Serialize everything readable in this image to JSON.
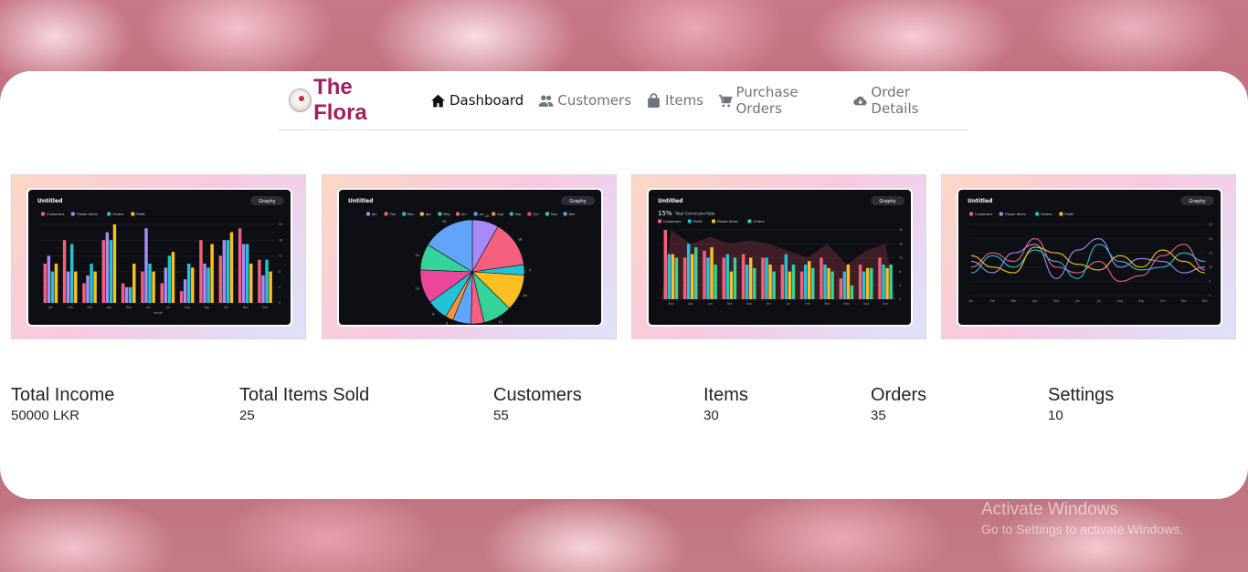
{
  "app": {
    "brand": "The Flora"
  },
  "nav": {
    "items": [
      {
        "label": "Dashboard",
        "icon": "home-icon",
        "active": true
      },
      {
        "label": "Customers",
        "icon": "users-icon",
        "active": false
      },
      {
        "label": "Items",
        "icon": "bag-icon",
        "active": false
      },
      {
        "label": "Purchase Orders",
        "icon": "cart-icon",
        "active": false
      },
      {
        "label": "Order Details",
        "icon": "cloud-download-icon",
        "active": false
      }
    ]
  },
  "cards": [
    {
      "title": "Untitled",
      "badge": "Graphy",
      "chart": "bar"
    },
    {
      "title": "Untitled",
      "badge": "Graphy",
      "chart": "pie"
    },
    {
      "title": "Untitled",
      "badge": "Graphy",
      "chart": "bar",
      "header_value": "15%",
      "header_label": "Total Conversion Rate"
    },
    {
      "title": "Untitled",
      "badge": "Graphy",
      "chart": "line"
    }
  ],
  "chart_data": [
    {
      "type": "bar",
      "title": "Untitled",
      "categories": [
        "Jan",
        "Feb",
        "Mar",
        "Apr",
        "May",
        "Jun",
        "Jul",
        "Aug",
        "Sep",
        "Oct",
        "Nov",
        "Dec"
      ],
      "xlabel": "month",
      "series": [
        {
          "name": "Customers",
          "values": [
            10,
            16,
            5,
            16,
            5,
            8,
            5,
            3,
            16,
            12,
            19,
            11
          ]
        },
        {
          "name": "Flower Items",
          "values": [
            12,
            8,
            7,
            18,
            4,
            19,
            9,
            6,
            10,
            16,
            15,
            7
          ]
        },
        {
          "name": "Orders",
          "values": [
            8,
            15,
            10,
            16,
            4,
            10,
            12,
            10,
            9,
            16,
            15,
            11
          ]
        },
        {
          "name": "Profit",
          "values": [
            10,
            8,
            8,
            20,
            10,
            8,
            13,
            9,
            15,
            18,
            10,
            8
          ]
        }
      ],
      "ylim": [
        0,
        20
      ]
    },
    {
      "type": "pie",
      "title": "Untitled",
      "categories": [
        "Jan",
        "Feb",
        "Mar",
        "Apr",
        "May",
        "Jun",
        "Jul",
        "Aug",
        "Sep",
        "Oct",
        "Nov",
        "Dec"
      ],
      "values": [
        10,
        18,
        4,
        14,
        11,
        5,
        7,
        3,
        8,
        13,
        10,
        20
      ]
    },
    {
      "type": "bar",
      "title": "Untitled",
      "categories": [
        "Nov",
        "Apr",
        "Jun",
        "Dec",
        "Sep",
        "Jan",
        "Jul",
        "Feb",
        "Mar",
        "May",
        "Aug",
        "Dec"
      ],
      "series": [
        {
          "name": "Customers",
          "values": [
            20,
            12,
            14,
            12,
            13,
            12,
            10,
            8,
            12,
            6,
            10,
            12
          ]
        },
        {
          "name": "Profit",
          "values": [
            13,
            16,
            12,
            13,
            10,
            12,
            13,
            10,
            10,
            8,
            8,
            10
          ]
        },
        {
          "name": "Flower Items",
          "values": [
            13,
            13,
            15,
            8,
            12,
            10,
            8,
            11,
            9,
            10,
            9,
            9
          ]
        },
        {
          "name": "Orders",
          "values": [
            12,
            15,
            10,
            12,
            9,
            8,
            10,
            9,
            8,
            4,
            9,
            10
          ]
        }
      ],
      "ylim": [
        0,
        20
      ]
    },
    {
      "type": "line",
      "title": "Untitled",
      "categories": [
        "Jan",
        "Feb",
        "Mar",
        "Apr",
        "May",
        "Jun",
        "Jul",
        "Aug",
        "Sep",
        "Oct",
        "Nov",
        "Dec"
      ],
      "series": [
        {
          "name": "Customers",
          "values": [
            10,
            15,
            12,
            20,
            10,
            8,
            12,
            5,
            7,
            14,
            18,
            9
          ]
        },
        {
          "name": "Flower Items",
          "values": [
            12,
            8,
            15,
            18,
            6,
            16,
            20,
            10,
            13,
            12,
            8,
            10
          ]
        },
        {
          "name": "Orders",
          "values": [
            8,
            14,
            10,
            16,
            12,
            6,
            18,
            12,
            9,
            10,
            15,
            12
          ]
        },
        {
          "name": "Profit",
          "values": [
            14,
            10,
            8,
            17,
            15,
            11,
            9,
            14,
            10,
            16,
            12,
            8
          ]
        }
      ],
      "ylim": [
        0,
        25
      ]
    }
  ],
  "stats": [
    {
      "title": "Total Income",
      "value": "50000 LKR"
    },
    {
      "title": "Total Items Sold",
      "value": "25"
    },
    {
      "title": "Customers",
      "value": "55"
    },
    {
      "title": "Items",
      "value": "30"
    },
    {
      "title": "Orders",
      "value": "35"
    },
    {
      "title": "Settings",
      "value": "10"
    }
  ],
  "watermark": {
    "line1": "Activate Windows",
    "line2": "Go to Settings to activate Windows."
  },
  "colors": {
    "brand": "#a3205a",
    "customers": "#f4607d",
    "flower_items": "#a78bfa",
    "orders": "#22c3d6",
    "profit": "#fbbf24",
    "series_extra": [
      "#34d399",
      "#60a5fa",
      "#fb923c",
      "#ec4899"
    ]
  }
}
